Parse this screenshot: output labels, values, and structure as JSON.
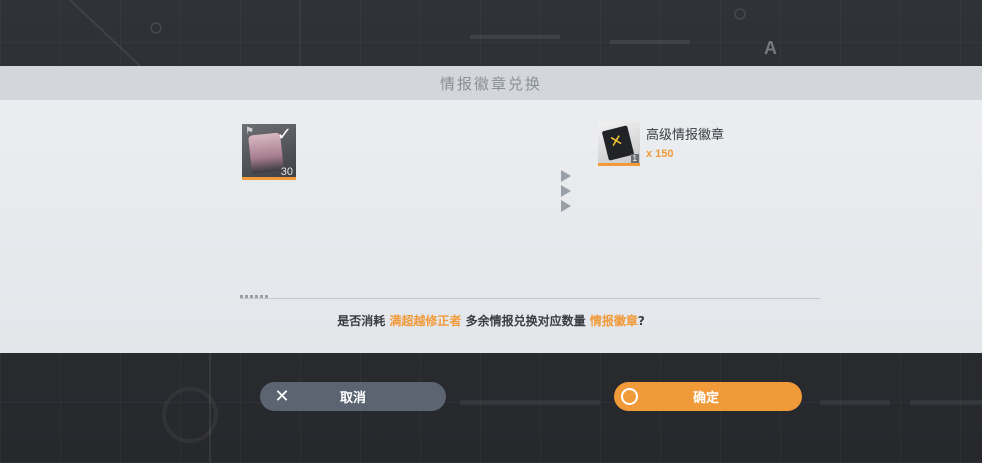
{
  "dialog": {
    "title": "情报徽章兑换",
    "consume_item": {
      "icon": "character-data-icon",
      "count": "30",
      "selected": true
    },
    "reward_item": {
      "icon": "intel-badge-icon",
      "name": "高级情报徽章",
      "quantity": "x 150",
      "tier": "1"
    },
    "question": {
      "prefix": "是否消耗",
      "highlight1": "满超越修正者",
      "middle": "多余情报兑换对应数量",
      "highlight2": "情报徽章",
      "suffix": "?"
    }
  },
  "buttons": {
    "cancel_label": "取消",
    "confirm_label": "确定"
  },
  "colors": {
    "accent": "#f19a3a",
    "cancel_bg": "#5b6470",
    "dialog_bg": "#e3e6ea"
  }
}
